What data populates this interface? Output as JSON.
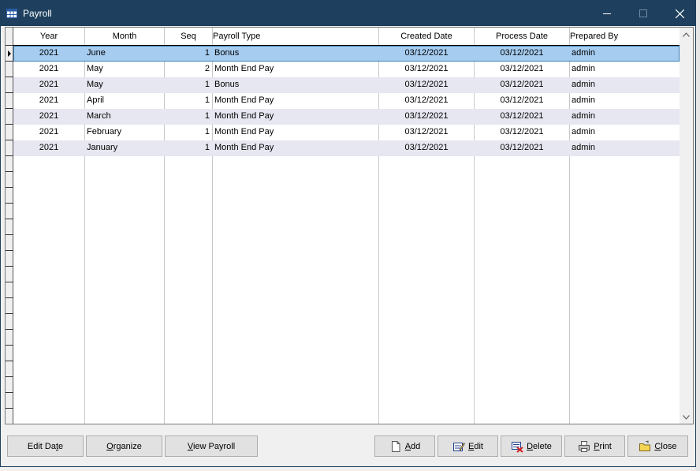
{
  "window": {
    "title": "Payroll",
    "title_icon": "grid-window-icon"
  },
  "titlebar_buttons": {
    "minimize": "—",
    "maximize": "☐",
    "close": "✕"
  },
  "grid": {
    "columns": [
      "Year",
      "Month",
      "Seq",
      "Payroll Type",
      "Created Date",
      "Process Date",
      "Prepared By"
    ],
    "rows": [
      {
        "year": "2021",
        "month": "June",
        "seq": "1",
        "type": "Bonus",
        "created": "03/12/2021",
        "process": "03/12/2021",
        "by": "admin"
      },
      {
        "year": "2021",
        "month": "May",
        "seq": "2",
        "type": "Month End Pay",
        "created": "03/12/2021",
        "process": "03/12/2021",
        "by": "admin"
      },
      {
        "year": "2021",
        "month": "May",
        "seq": "1",
        "type": "Bonus",
        "created": "03/12/2021",
        "process": "03/12/2021",
        "by": "admin"
      },
      {
        "year": "2021",
        "month": "April",
        "seq": "1",
        "type": "Month End Pay",
        "created": "03/12/2021",
        "process": "03/12/2021",
        "by": "admin"
      },
      {
        "year": "2021",
        "month": "March",
        "seq": "1",
        "type": "Month End Pay",
        "created": "03/12/2021",
        "process": "03/12/2021",
        "by": "admin"
      },
      {
        "year": "2021",
        "month": "February",
        "seq": "1",
        "type": "Month End Pay",
        "created": "03/12/2021",
        "process": "03/12/2021",
        "by": "admin"
      },
      {
        "year": "2021",
        "month": "January",
        "seq": "1",
        "type": "Month End Pay",
        "created": "03/12/2021",
        "process": "03/12/2021",
        "by": "admin"
      }
    ],
    "selected_row_index": 0
  },
  "scrollbar": {
    "up": "⌃",
    "down": "⌄"
  },
  "buttons": {
    "edit_date": {
      "pre": "Edit Da",
      "ul": "t",
      "post": "e"
    },
    "organize": {
      "pre": "",
      "ul": "O",
      "post": "rganize"
    },
    "view_payroll": {
      "pre": "",
      "ul": "V",
      "post": "iew Payroll"
    },
    "add": {
      "pre": "",
      "ul": "A",
      "post": "dd"
    },
    "edit": {
      "pre": "",
      "ul": "E",
      "post": "dit"
    },
    "delete": {
      "pre": "",
      "ul": "D",
      "post": "elete"
    },
    "print": {
      "pre": "",
      "ul": "P",
      "post": "rint"
    },
    "close": {
      "pre": "",
      "ul": "C",
      "post": "lose"
    }
  },
  "colors": {
    "titlebar": "#1e3f5e",
    "selected_row": "#a6cdf0",
    "alt_row": "#e7e7f1"
  }
}
